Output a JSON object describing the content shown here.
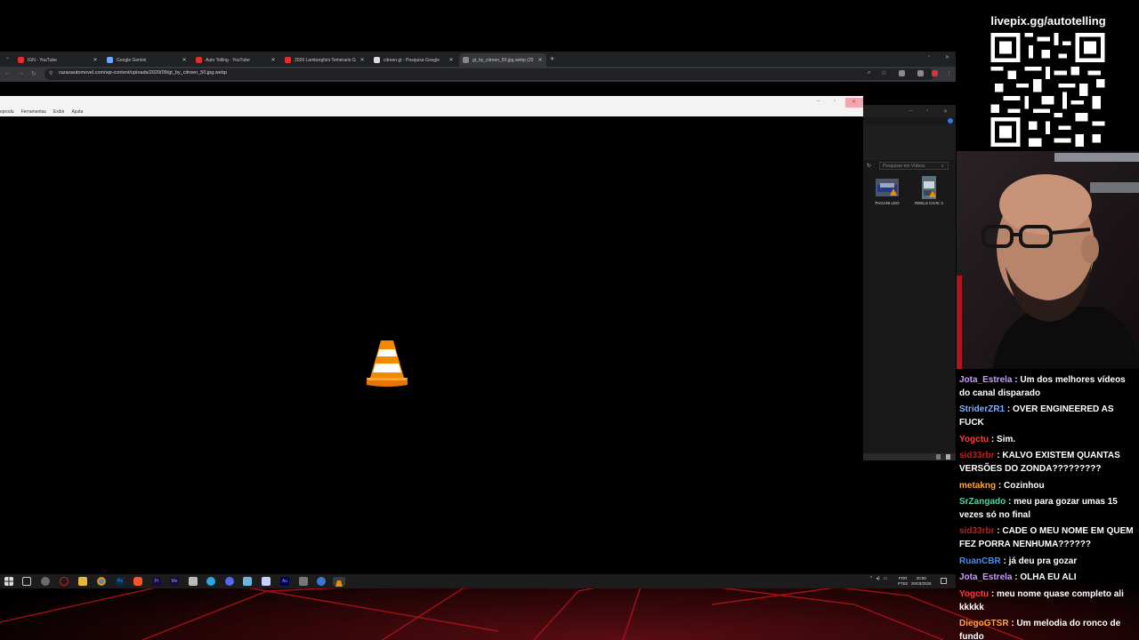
{
  "browser": {
    "tabs": [
      {
        "title": "IGN - YouTube",
        "fav_color": "#e02d2d",
        "active": false
      },
      {
        "title": "Google Gemini",
        "fav_color": "#6fa8ff",
        "active": false
      },
      {
        "title": "Auto Telling - YouTube",
        "fav_color": "#e02d2d",
        "active": false
      },
      {
        "title": "2026 Lamborghini Temerario G",
        "fav_color": "#e02d2d",
        "active": false
      },
      {
        "title": "citroen gt - Pesquisa Google",
        "fav_color": "#dddddd",
        "active": false
      },
      {
        "title": "gt_by_citroen_50.jpg.webp (20",
        "fav_color": "#888888",
        "active": true
      }
    ],
    "new_tab": "+",
    "url": "razaoautomovel.com/wp-content/uploads/2020/09/gt_by_citroen_50.jpg.webp"
  },
  "vlc": {
    "menu": [
      "Reprodução",
      "Ferramentas",
      "Exibir",
      "Ajuda"
    ],
    "menu_visible": [
      "eprodu",
      "Ferramentas",
      "Exibir",
      "Ajuda"
    ]
  },
  "explorer": {
    "search_placeholder": "Pesquisar em Vídeos",
    "items": [
      {
        "label": "PAGANI LEO"
      },
      {
        "label": "REELS CIVIC 2"
      }
    ]
  },
  "taskbar": {
    "lang_line1": "POR",
    "lang_line2": "PTB2",
    "time": "20:50",
    "date": "20/03/2026"
  },
  "overlay": {
    "livepix": "livepix.gg/autotelling"
  },
  "chat": [
    {
      "user": "Jota_Estrela",
      "color": "#c89cff",
      "text": "Um dos melhores vídeos do canal disparado"
    },
    {
      "user": "StriderZR1",
      "color": "#7fb0ff",
      "text": "OVER ENGINEERED AS FUCK"
    },
    {
      "user": "Yogctu",
      "color": "#ff3b3b",
      "text": "Sim."
    },
    {
      "user": "sid33rbr",
      "color": "#b22222",
      "text": "KALVO EXISTEM QUANTAS VERSÕES DO ZONDA?????????"
    },
    {
      "user": "metakng",
      "color": "#ffa43a",
      "text": "Cozinhou"
    },
    {
      "user": "SrZangado",
      "color": "#52d6a0",
      "text": "meu para gozar umas 15 vezes só no final"
    },
    {
      "user": "sid33rbr",
      "color": "#b22222",
      "text": "CADE O MEU NOME EM QUEM FEZ PORRA NENHUMA??????"
    },
    {
      "user": "RuanCBR",
      "color": "#3f8fff",
      "text": "já deu pra gozar"
    },
    {
      "user": "Jota_Estrela",
      "color": "#c89cff",
      "text": "OLHA EU ALI"
    },
    {
      "user": "Yogctu",
      "color": "#ff3b3b",
      "text": "meu nome quase completo ali kkkkk"
    },
    {
      "user": "DiegoGTSR",
      "color": "#ffa43a",
      "text": "Um melodia do ronco de fundo"
    }
  ]
}
